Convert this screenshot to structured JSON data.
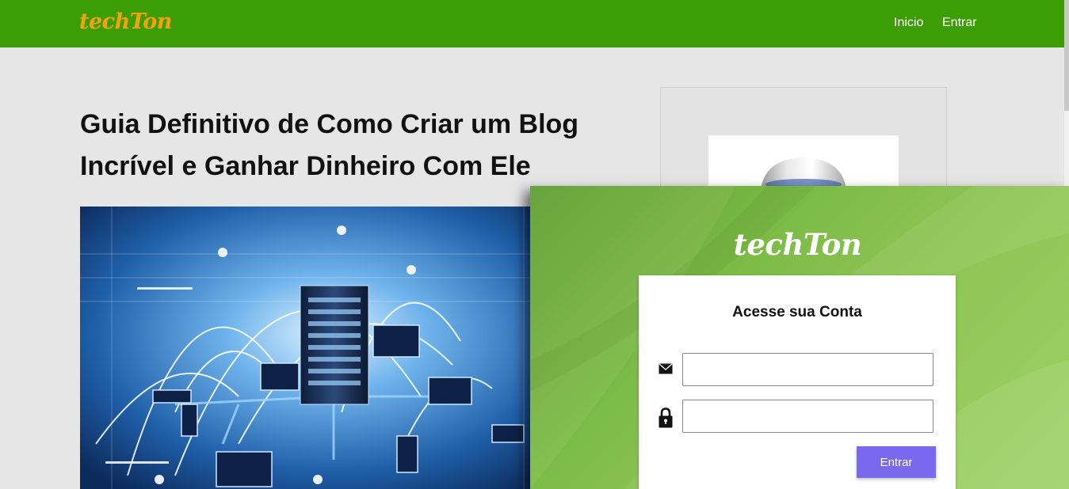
{
  "header": {
    "logo": "techTon",
    "nav": [
      {
        "label": "Inicio"
      },
      {
        "label": "Entrar"
      }
    ]
  },
  "article": {
    "title": "Guia Definitivo de Como Criar um Blog Incrível e Ganhar Dinheiro Com Ele",
    "hero_image": "network-server-illustration"
  },
  "sidebar": {
    "image": "mug-photo"
  },
  "login_modal": {
    "logo": "techTon",
    "title": "Acesse sua Conta",
    "email_icon": "envelope-icon",
    "email_value": "",
    "password_icon": "lock-icon",
    "password_value": "",
    "submit_label": "Entrar"
  },
  "colors": {
    "navbar": "#3c9e04",
    "logo": "#f4a20a",
    "modal_green": "#8fc655",
    "submit": "#7b68ee"
  }
}
